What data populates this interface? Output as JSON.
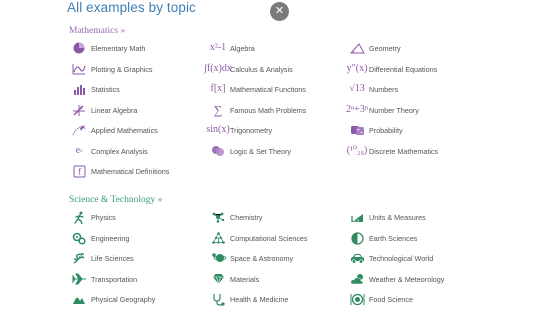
{
  "page": {
    "title": "All examples by topic",
    "close_symbol": "✕"
  },
  "math": {
    "heading": "Mathematics »",
    "col1": [
      {
        "label": "Elementary Math",
        "icon": "pie-chart-icon"
      },
      {
        "label": "Plotting & Graphics",
        "icon": "plot-curve-icon"
      },
      {
        "label": "Statistics",
        "icon": "bar-chart-icon"
      },
      {
        "label": "Linear Algebra",
        "icon": "vector-arrows-icon"
      },
      {
        "label": "Applied Mathematics",
        "icon": "plane-trajectory-icon"
      },
      {
        "label": "Complex Analysis",
        "icon": "complex-exponential-icon"
      },
      {
        "label": "Mathematical Definitions",
        "icon": "definition-book-icon"
      }
    ],
    "col2": [
      {
        "label": "Algebra",
        "icon": "x-squared-icon",
        "glyph": "x²-1"
      },
      {
        "label": "Calculus & Analysis",
        "icon": "integral-icon",
        "glyph": "∫f(x)dx"
      },
      {
        "label": "Mathematical Functions",
        "icon": "function-icon",
        "glyph": "f[x]"
      },
      {
        "label": "Famous Math Problems",
        "icon": "sigma-icon",
        "glyph": "∑"
      },
      {
        "label": "Trigonometry",
        "icon": "sine-icon",
        "glyph": "sin(x)"
      },
      {
        "label": "Logic & Set Theory",
        "icon": "venn-diagram-icon"
      }
    ],
    "col3": [
      {
        "label": "Geometry",
        "icon": "triangle-angle-icon"
      },
      {
        "label": "Differential Equations",
        "icon": "derivative-icon",
        "glyph": "y″(x)"
      },
      {
        "label": "Numbers",
        "icon": "square-root-icon",
        "glyph": "√13"
      },
      {
        "label": "Number Theory",
        "icon": "power-sum-icon",
        "glyph": "2ⁿ+3ⁿ"
      },
      {
        "label": "Probability",
        "icon": "dice-icon"
      },
      {
        "label": "Discrete Mathematics",
        "icon": "binomial-icon",
        "glyph": "(¹⁰₂₈)"
      }
    ]
  },
  "science": {
    "heading": "Science & Technology »",
    "col1": [
      {
        "label": "Physics",
        "icon": "running-person-icon"
      },
      {
        "label": "Engineering",
        "icon": "gears-icon"
      },
      {
        "label": "Life Sciences",
        "icon": "dna-icon"
      },
      {
        "label": "Transportation",
        "icon": "airplane-icon"
      },
      {
        "label": "Physical Geography",
        "icon": "mountain-icon"
      }
    ],
    "col2": [
      {
        "label": "Chemistry",
        "icon": "molecule-icon"
      },
      {
        "label": "Computational Sciences",
        "icon": "network-triangle-icon"
      },
      {
        "label": "Space & Astronomy",
        "icon": "planet-icon"
      },
      {
        "label": "Materials",
        "icon": "diamond-icon"
      },
      {
        "label": "Health & Medicine",
        "icon": "stethoscope-icon"
      }
    ],
    "col3": [
      {
        "label": "Units & Measures",
        "icon": "scale-icon"
      },
      {
        "label": "Earth Sciences",
        "icon": "globe-half-icon"
      },
      {
        "label": "Technological World",
        "icon": "car-icon"
      },
      {
        "label": "Weather & Meteorology",
        "icon": "cloud-sun-icon"
      },
      {
        "label": "Food Science",
        "icon": "food-plate-icon"
      }
    ]
  },
  "colors": {
    "title": "#3f7fb5",
    "math_accent": "#8a5aa8",
    "science_accent": "#2e8b62",
    "close_bg": "#7b7b7b"
  }
}
